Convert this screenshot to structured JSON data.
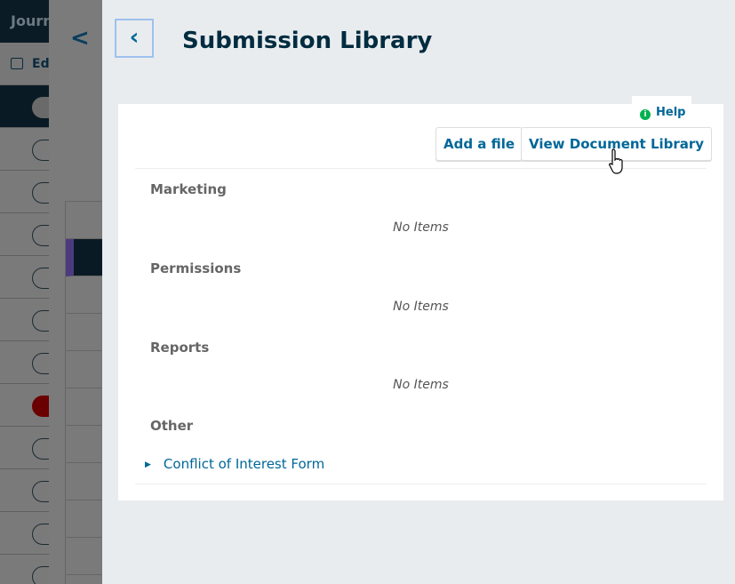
{
  "background": {
    "app_title": "Journ",
    "nav_item": "Ed"
  },
  "modal": {
    "title": "Submission Library",
    "back_label": "‹",
    "help_label": "Help",
    "buttons": {
      "add_file": "Add a file",
      "view_library": "View Document Library"
    },
    "categories": [
      {
        "name": "Marketing",
        "empty": "No Items"
      },
      {
        "name": "Permissions",
        "empty": "No Items"
      },
      {
        "name": "Reports",
        "empty": "No Items"
      },
      {
        "name": "Other",
        "files": [
          "Conflict of Interest Form"
        ]
      }
    ]
  },
  "colors": {
    "link": "#006798",
    "title": "#002c40",
    "help_icon": "#00b24e"
  }
}
